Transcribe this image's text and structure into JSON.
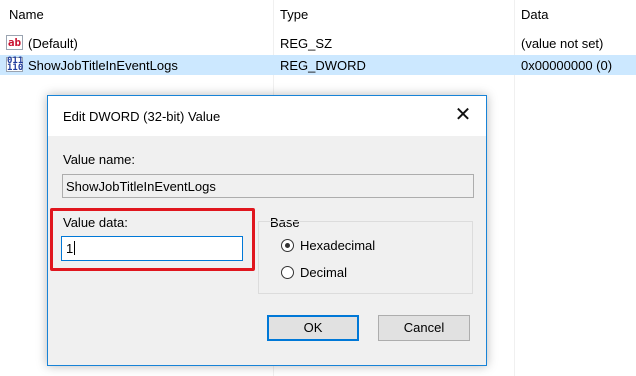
{
  "columns": {
    "name": "Name",
    "type": "Type",
    "data": "Data"
  },
  "values": [
    {
      "icon": "string-value-icon",
      "icon_glyph": "ab",
      "name": "(Default)",
      "type": "REG_SZ",
      "data": "(value not set)",
      "selected": false
    },
    {
      "icon": "binary-value-icon",
      "icon_glyph": "011\n110",
      "name": "ShowJobTitleInEventLogs",
      "type": "REG_DWORD",
      "data": "0x00000000 (0)",
      "selected": true
    }
  ],
  "dialog": {
    "title": "Edit DWORD (32-bit) Value",
    "close_glyph": "✕",
    "value_name_label": "Value name:",
    "value_name": "ShowJobTitleInEventLogs",
    "value_data_label": "Value data:",
    "value_data": "1",
    "base_label": "Base",
    "base_options": [
      "Hexadecimal",
      "Decimal"
    ],
    "base_selected": "Hexadecimal",
    "ok_label": "OK",
    "cancel_label": "Cancel"
  },
  "colors": {
    "selection": "#cce8ff",
    "highlight_box": "#e0161e",
    "accent": "#0078d7"
  }
}
